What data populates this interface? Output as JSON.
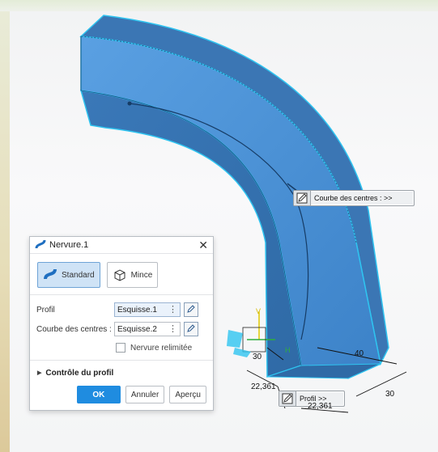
{
  "dialog": {
    "title": "Nervure.1",
    "close_glyph": "✕",
    "modes": [
      {
        "label": "Standard",
        "active": true,
        "icon": "rib-icon"
      },
      {
        "label": "Mince",
        "active": false,
        "icon": "thin-box-icon"
      }
    ],
    "fields": [
      {
        "label": "Profil",
        "value": "Esquisse.1"
      },
      {
        "label": "Courbe des centres :",
        "value": "Esquisse.2"
      }
    ],
    "checkbox_label": "Nervure relimitée",
    "checkbox_checked": false,
    "section_label": "Contrôle du profil",
    "buttons": {
      "ok": "OK",
      "cancel": "Annuler",
      "preview": "Aperçu"
    }
  },
  "viewport": {
    "callout_center_curve": "Courbe des centres : >>",
    "callout_profile": "Profil >>",
    "dimensions": {
      "d1": "30",
      "d2": "40",
      "d3": "22,361",
      "d4": "22,361",
      "d5": "30"
    },
    "axis_labels": {
      "v": "V",
      "h": "H"
    },
    "colors": {
      "solid": "#4a92d8",
      "solid_dark": "#3a7cc0",
      "outline": "#2fc4f0"
    }
  }
}
